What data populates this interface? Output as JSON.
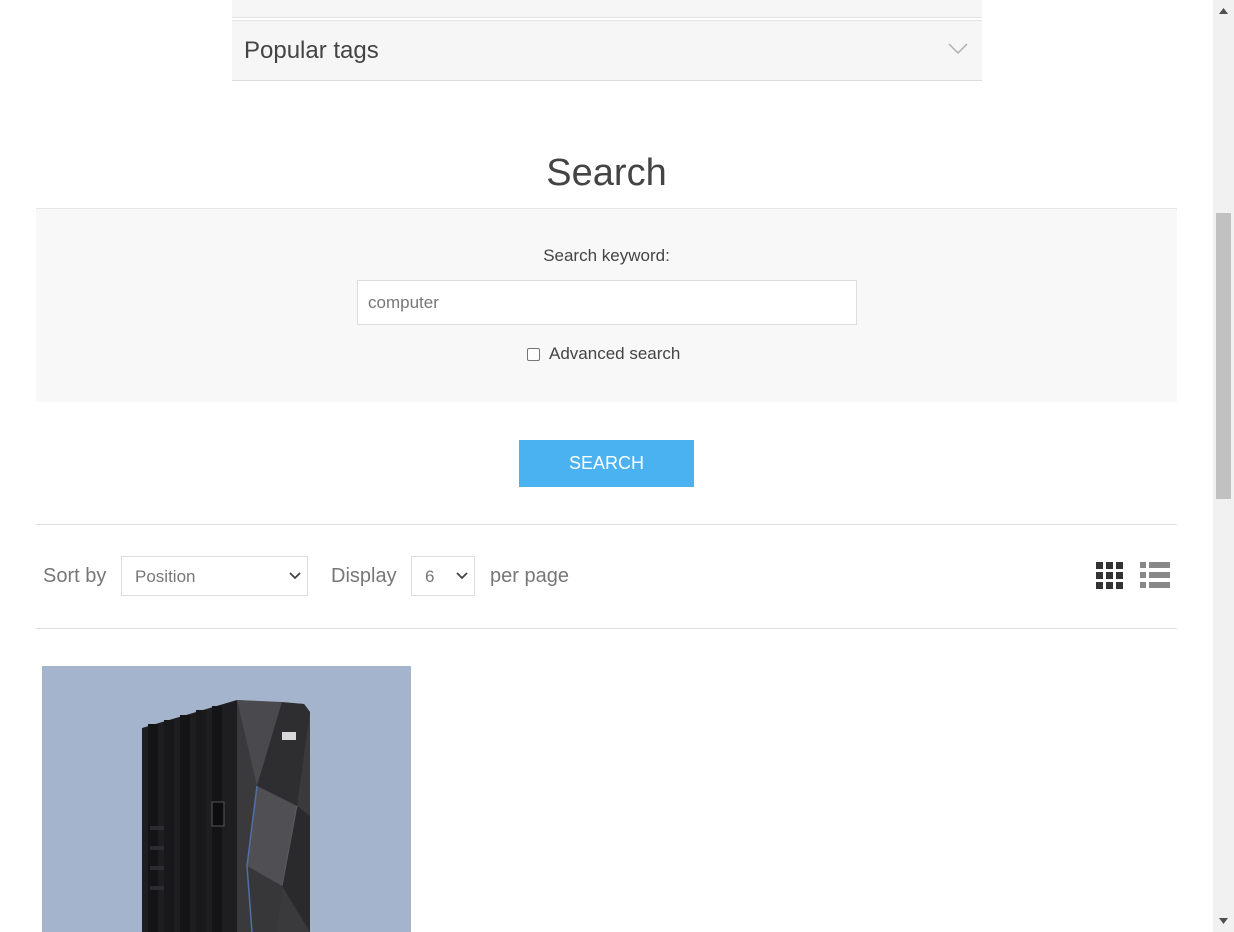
{
  "accordion": {
    "popular_tags_title": "Popular tags"
  },
  "page": {
    "title": "Search"
  },
  "search": {
    "keyword_label": "Search keyword:",
    "keyword_value": "computer",
    "advanced_label": "Advanced search",
    "advanced_checked": false,
    "button_label": "Search"
  },
  "toolbar": {
    "sort_label": "Sort by",
    "sort_value": "Position",
    "display_label": "Display",
    "display_value": "6",
    "per_page_label": "per page"
  },
  "colors": {
    "accent_button": "#4ab2f1",
    "panel_bg": "#f8f8f8",
    "product_bg": "#a4b4cc"
  },
  "icons": {
    "accordion": "chevron-down-icon",
    "grid_view": "grid-view-icon",
    "list_view": "list-view-icon"
  }
}
